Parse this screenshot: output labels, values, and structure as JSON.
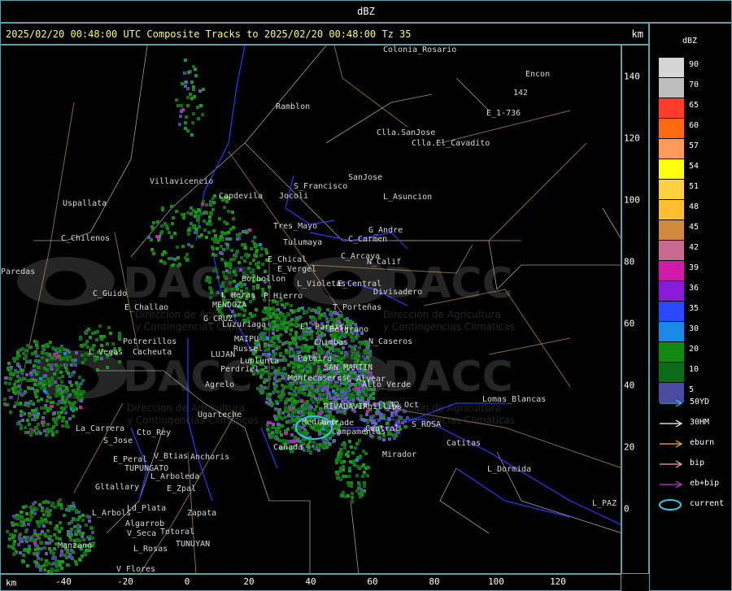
{
  "header": {
    "unit_title": "dBZ"
  },
  "map": {
    "title": "2025/02/20 00:48:00 UTC Composite Tracks to 2025/02/20 00:48:00 Tz 35",
    "km_label": "km",
    "watermark": {
      "brand": "DACC",
      "line1": "Dirección de Agricultura",
      "line2": "y Contingencias Climáticas"
    },
    "places": [
      {
        "name": "Colonia_Rosario"
      },
      {
        "name": "Encon"
      },
      {
        "name": "142"
      },
      {
        "name": "E_1-736"
      },
      {
        "name": "Ramblon"
      },
      {
        "name": "Clla.SanJose"
      },
      {
        "name": "Clla.El_Cavadito"
      },
      {
        "name": "Villavicencio"
      },
      {
        "name": "S_Francisco"
      },
      {
        "name": "SanJose"
      },
      {
        "name": "Uspallata"
      },
      {
        "name": "Capdevila"
      },
      {
        "name": "Jocoli"
      },
      {
        "name": "L_Asuncion"
      },
      {
        "name": "Tres_Mayo"
      },
      {
        "name": "G_Andre"
      },
      {
        "name": "Tulumaya"
      },
      {
        "name": "C_Carmen"
      },
      {
        "name": "C_Chilenos"
      },
      {
        "name": "E_Chical"
      },
      {
        "name": "C_Arcaya"
      },
      {
        "name": "N_Calif"
      },
      {
        "name": "E_Vergel"
      },
      {
        "name": "Paredas"
      },
      {
        "name": "Borbollon"
      },
      {
        "name": "L_Violetas"
      },
      {
        "name": "E_Central"
      },
      {
        "name": "Divisadero"
      },
      {
        "name": "C_Guido"
      },
      {
        "name": "L_Heras"
      },
      {
        "name": "P_Hierro"
      },
      {
        "name": "MENDOZA"
      },
      {
        "name": "E_Challao"
      },
      {
        "name": "T_Porteñas"
      },
      {
        "name": "G_CRUZ"
      },
      {
        "name": "Luzuriaga"
      },
      {
        "name": "El_Paraiso"
      },
      {
        "name": "Belgrano"
      },
      {
        "name": "Potrerillos"
      },
      {
        "name": "MAIPU"
      },
      {
        "name": "Russel"
      },
      {
        "name": "Chimbas"
      },
      {
        "name": "N_Caseros"
      },
      {
        "name": "L_Vegas"
      },
      {
        "name": "Cacheuta"
      },
      {
        "name": "LUJAN"
      },
      {
        "name": "Lunlunta"
      },
      {
        "name": "Palmira"
      },
      {
        "name": "SAN_MARTIN"
      },
      {
        "name": "Perdriel"
      },
      {
        "name": "Agrelo"
      },
      {
        "name": "Montecaseros"
      },
      {
        "name": "C_Alvear"
      },
      {
        "name": "Alto_Verde"
      },
      {
        "name": "Ugarteche"
      },
      {
        "name": "RIVADAVIA"
      },
      {
        "name": "12_Oct"
      },
      {
        "name": "Lomas_Blancas"
      },
      {
        "name": "Medrano"
      },
      {
        "name": "Phillips"
      },
      {
        "name": "Andrade"
      },
      {
        "name": "S_ROSA"
      },
      {
        "name": "La_Carrera"
      },
      {
        "name": "Cto_Rey"
      },
      {
        "name": "Central"
      },
      {
        "name": "Campamentos"
      },
      {
        "name": "S_Jose"
      },
      {
        "name": "Cañada"
      },
      {
        "name": "Catitas"
      },
      {
        "name": "Mirador"
      },
      {
        "name": "E_Peral"
      },
      {
        "name": "V_Btias"
      },
      {
        "name": "Anchoris"
      },
      {
        "name": "TUPUNGATO"
      },
      {
        "name": "L_Dormida"
      },
      {
        "name": "L_Arboleda"
      },
      {
        "name": "Gltallary"
      },
      {
        "name": "E_Zpal"
      },
      {
        "name": "L_PAZ"
      },
      {
        "name": "Ld_Plata"
      },
      {
        "name": "Zapata"
      },
      {
        "name": "L_Arbols"
      },
      {
        "name": "Algarrob"
      },
      {
        "name": "V_Seca"
      },
      {
        "name": "Totoral"
      },
      {
        "name": "TUNUYAN"
      },
      {
        "name": "Manzano"
      },
      {
        "name": "L_Rosas"
      },
      {
        "name": "V_Flores"
      }
    ]
  },
  "axes": {
    "x_label": "km",
    "x_ticks": [
      "-40",
      "-20",
      "0",
      "20",
      "40",
      "60",
      "80",
      "100",
      "120"
    ],
    "y_ticks": [
      "140",
      "120",
      "100",
      "80",
      "60",
      "40",
      "20",
      "0"
    ]
  },
  "legend": {
    "title": "dBZ",
    "scale": [
      {
        "label": "90",
        "color": "#d6d6d6"
      },
      {
        "label": "70",
        "color": "#bdbdbd"
      },
      {
        "label": "65",
        "color": "#ff3b2a"
      },
      {
        "label": "60",
        "color": "#ff6a10"
      },
      {
        "label": "57",
        "color": "#ff9a5a"
      },
      {
        "label": "54",
        "color": "#ffff10"
      },
      {
        "label": "51",
        "color": "#ffd040"
      },
      {
        "label": "48",
        "color": "#ffc030"
      },
      {
        "label": "45",
        "color": "#d08a40"
      },
      {
        "label": "42",
        "color": "#c86a90"
      },
      {
        "label": "39",
        "color": "#d21aa8"
      },
      {
        "label": "36",
        "color": "#8a1ad8"
      },
      {
        "label": "35",
        "color": "#2a48ff"
      },
      {
        "label": "30",
        "color": "#1a88e6"
      },
      {
        "label": "20",
        "color": "#118811"
      },
      {
        "label": "10",
        "color": "#0d6a16"
      },
      {
        "label": "5",
        "color": "#4a4aa0"
      }
    ],
    "tracks": [
      {
        "label": "50YD",
        "color": "#30c8e8"
      },
      {
        "label": "30HM",
        "color": "#ffffff"
      },
      {
        "label": "eburn",
        "color": "#ffb020"
      },
      {
        "label": "bip",
        "color": "#f8a0c0"
      },
      {
        "label": "eb+bip",
        "color": "#d030e0"
      },
      {
        "label": "current",
        "color": "#30d0e8"
      }
    ]
  }
}
